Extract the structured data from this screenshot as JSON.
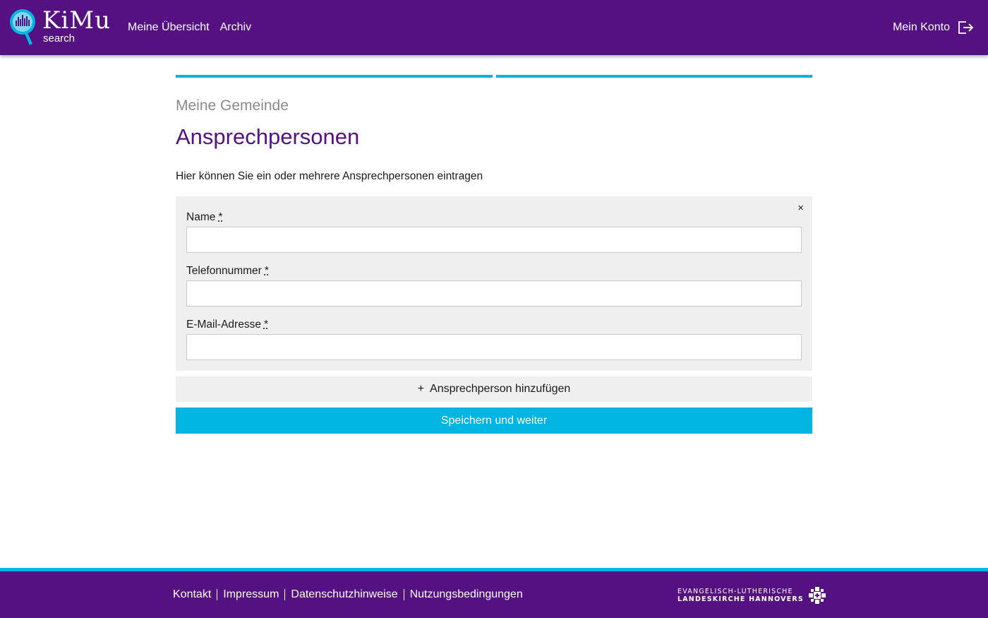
{
  "header": {
    "logo_word": "KiMu",
    "logo_sub": "search",
    "nav": [
      {
        "label": "Meine Übersicht"
      },
      {
        "label": "Archiv"
      }
    ],
    "account_label": "Mein Konto",
    "account_icon": "logout-icon",
    "color": "#551181"
  },
  "progress": {
    "steps": 2,
    "color": "#00b5e2"
  },
  "main": {
    "kicker": "Meine Gemeinde",
    "title": "Ansprechpersonen",
    "intro": "Hier können Sie ein oder mehrere Ansprechpersonen eintragen",
    "contact_card": {
      "close_icon": "close-icon",
      "close_glyph": "×",
      "fields": [
        {
          "label": "Name",
          "required_mark": "*",
          "value": ""
        },
        {
          "label": "Telefonnummer",
          "required_mark": "*",
          "value": ""
        },
        {
          "label": "E-Mail-Adresse",
          "required_mark": "*",
          "value": ""
        }
      ]
    },
    "add_button": {
      "glyph": "+",
      "label": "Ansprechperson hinzufügen"
    },
    "save_button": {
      "label": "Speichern und weiter",
      "color": "#00b5e2"
    }
  },
  "footer": {
    "links": [
      {
        "label": "Kontakt"
      },
      {
        "label": "Impressum"
      },
      {
        "label": "Datenschutzhinweise"
      },
      {
        "label": "Nutzungsbedingungen"
      }
    ],
    "church_line1": "EVANGELISCH-LUTHERISCHE",
    "church_line2": "LANDESKIRCHE HANNOVERS"
  }
}
